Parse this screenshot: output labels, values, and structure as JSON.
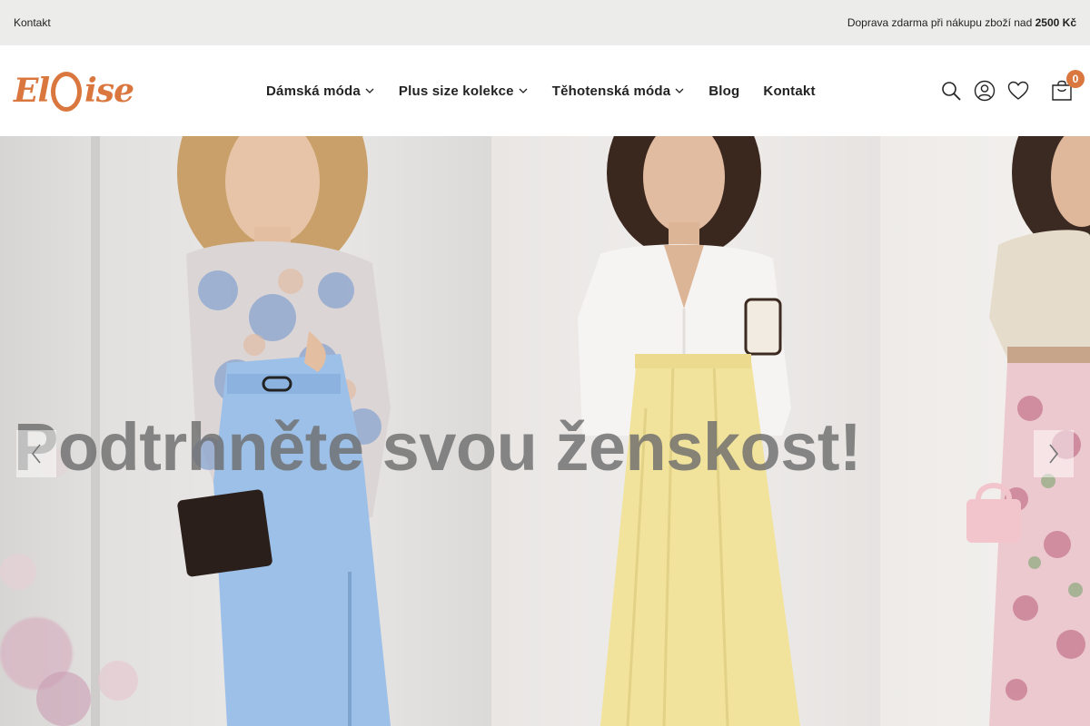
{
  "topbar": {
    "contact_link": "Kontakt",
    "shipping_text": "Doprava zdarma při nákupu zboží nad",
    "shipping_amount": "2500 Kč"
  },
  "header": {
    "logo_left": "El",
    "logo_right": "ise",
    "nav": [
      {
        "label": "Dámská móda",
        "dropdown": true
      },
      {
        "label": "Plus size kolekce",
        "dropdown": true
      },
      {
        "label": "Těhotenská móda",
        "dropdown": true
      },
      {
        "label": "Blog",
        "dropdown": false
      },
      {
        "label": "Kontakt",
        "dropdown": false
      }
    ],
    "icons": [
      "search-icon",
      "user-icon",
      "heart-icon",
      "cart-icon"
    ],
    "cart_count": "0"
  },
  "hero": {
    "headline": "Podtrhněte svou ženskost!"
  },
  "colors": {
    "brand": "#d9773e",
    "topbar_bg": "#ecedea",
    "text": "#222222"
  }
}
